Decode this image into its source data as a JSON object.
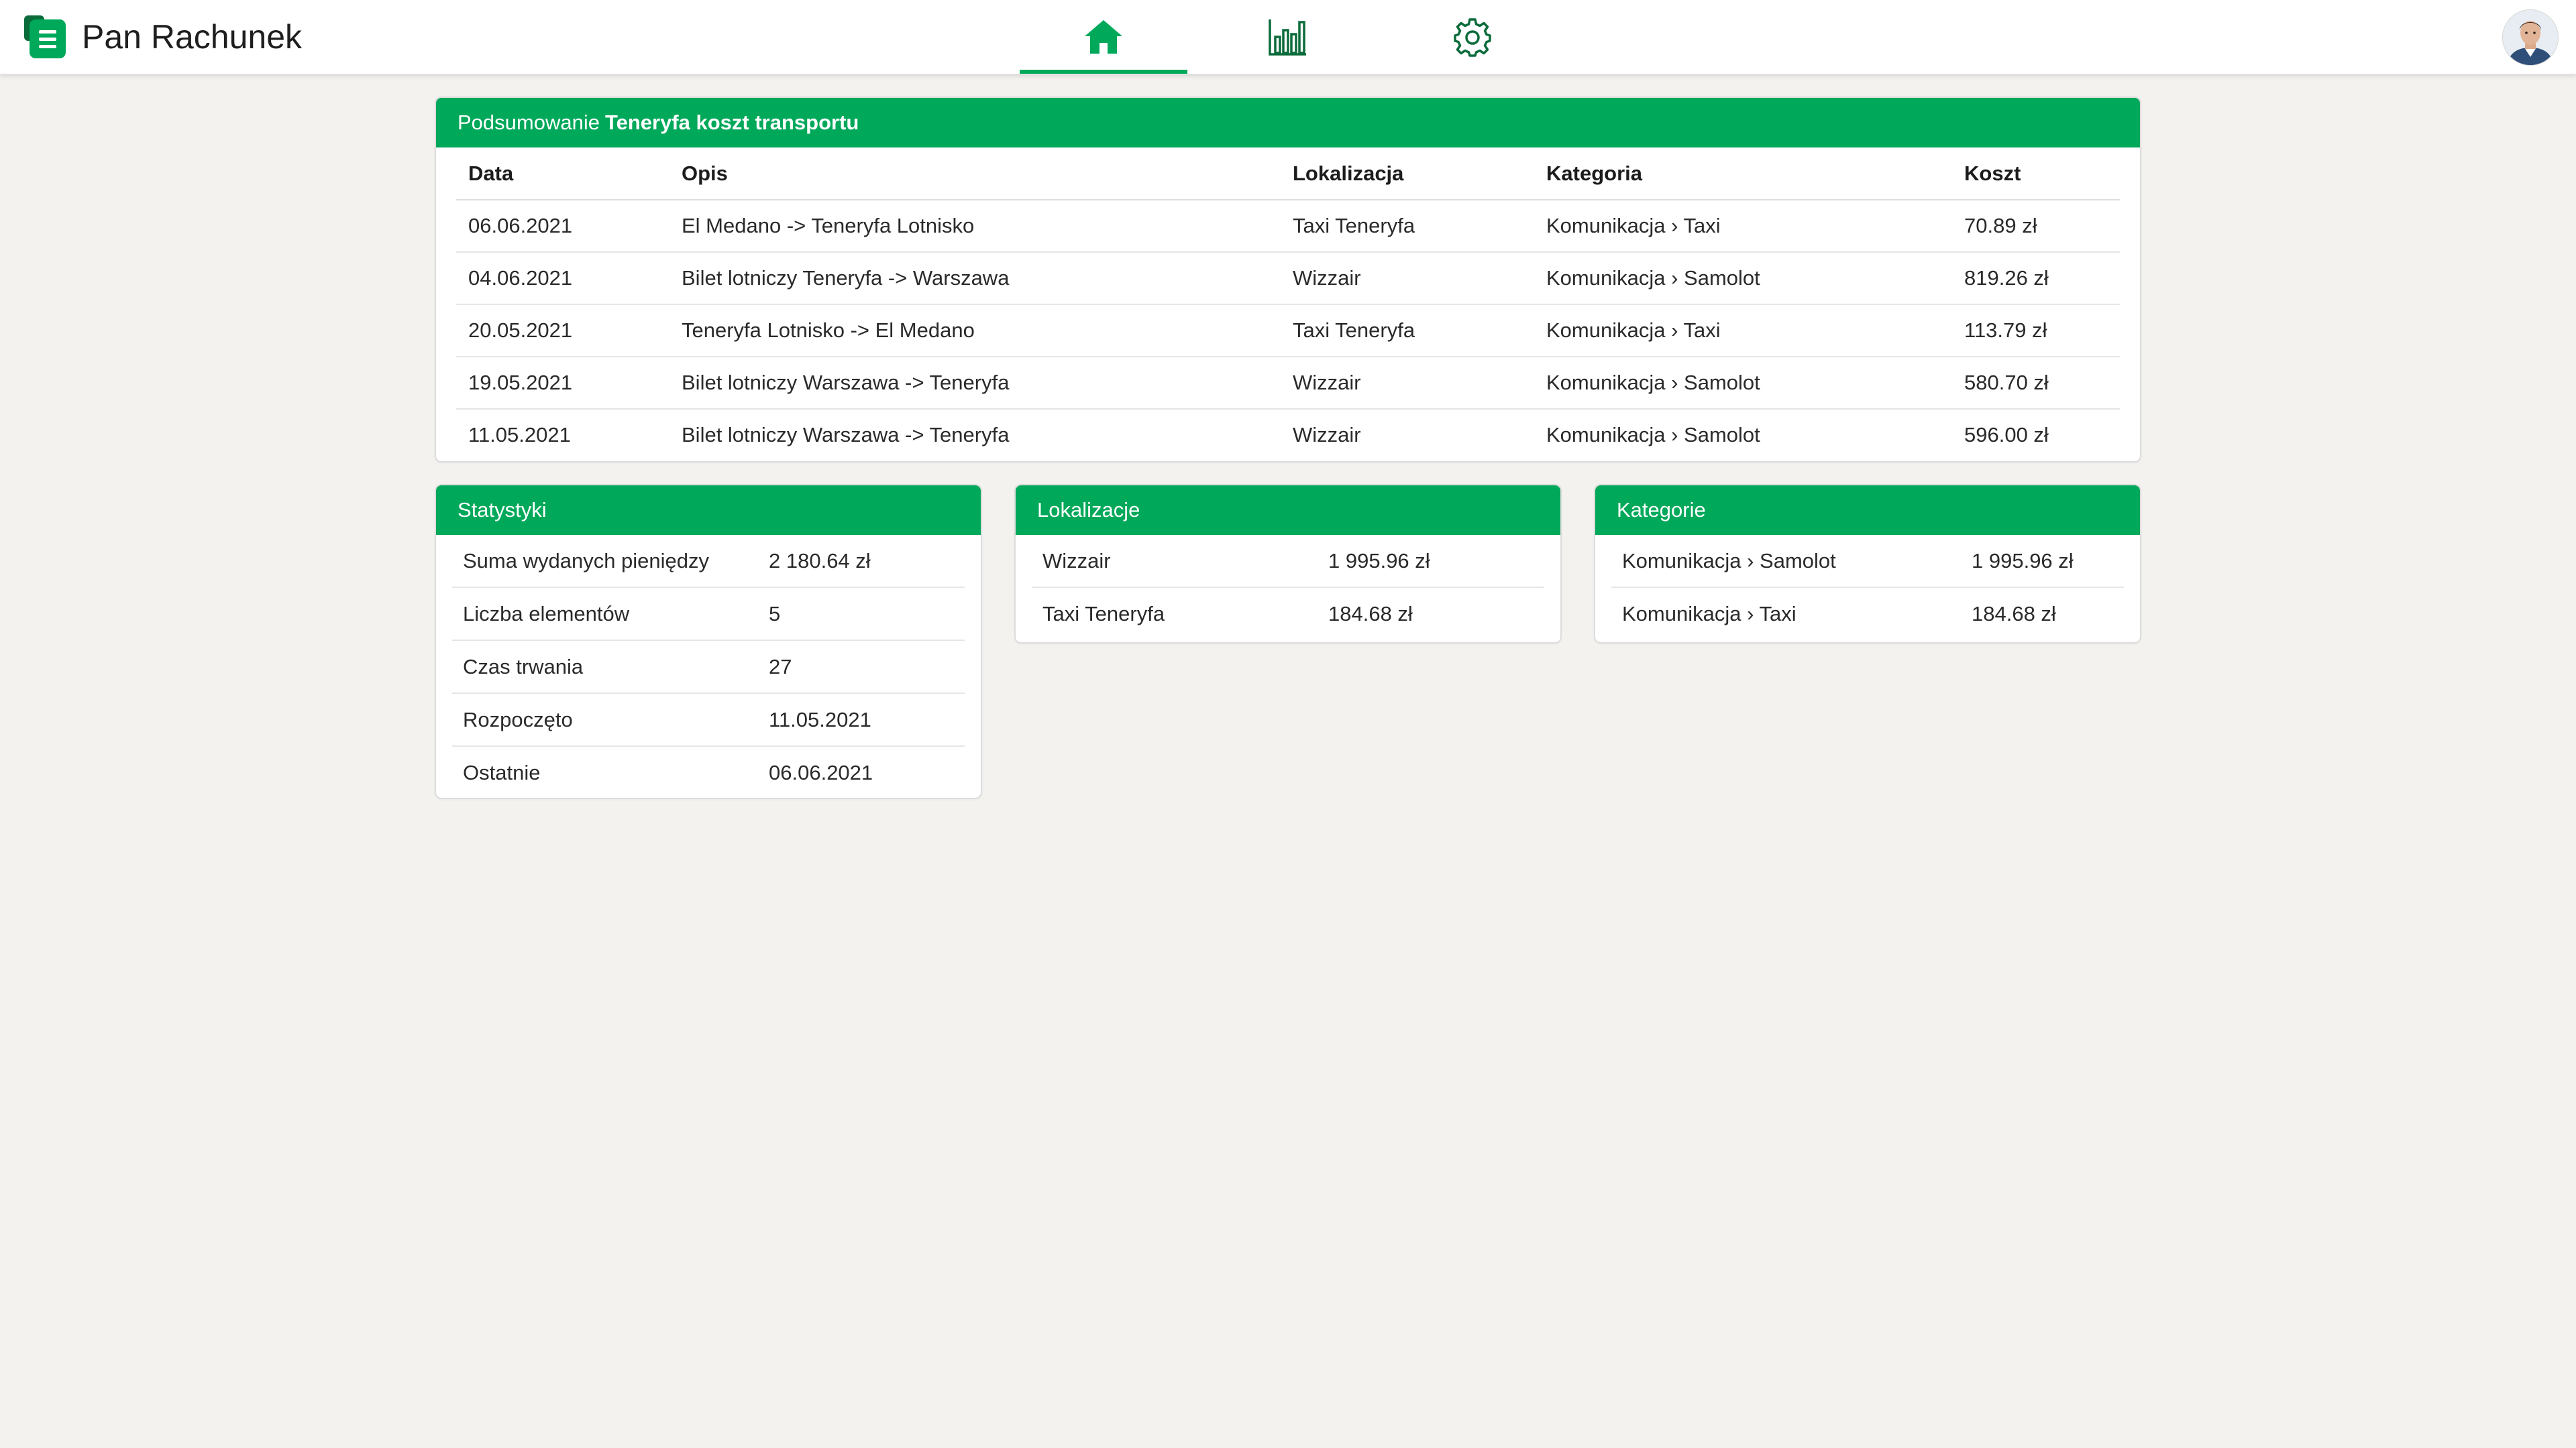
{
  "app": {
    "title": "Pan Rachunek",
    "accent_color": "#00a85a",
    "logo_icon": "receipt-logo-icon",
    "avatar_icon": "user-avatar-icon"
  },
  "nav": {
    "tabs": [
      {
        "icon": "home-icon",
        "active": true
      },
      {
        "icon": "bar-chart-icon",
        "active": false
      },
      {
        "icon": "gear-icon",
        "active": false
      }
    ]
  },
  "summary": {
    "header_prefix": "Podsumowanie",
    "header_name": "Teneryfa koszt transportu",
    "columns": [
      "Data",
      "Opis",
      "Lokalizacja",
      "Kategoria",
      "Koszt"
    ],
    "rows": [
      [
        "06.06.2021",
        "El Medano -> Teneryfa Lotnisko",
        "Taxi Teneryfa",
        "Komunikacja › Taxi",
        "70.89 zł"
      ],
      [
        "04.06.2021",
        "Bilet lotniczy Teneryfa -> Warszawa",
        "Wizzair",
        "Komunikacja › Samolot",
        "819.26 zł"
      ],
      [
        "20.05.2021",
        "Teneryfa Lotnisko -> El Medano",
        "Taxi Teneryfa",
        "Komunikacja › Taxi",
        "113.79 zł"
      ],
      [
        "19.05.2021",
        "Bilet lotniczy Warszawa -> Teneryfa",
        "Wizzair",
        "Komunikacja › Samolot",
        "580.70 zł"
      ],
      [
        "11.05.2021",
        "Bilet lotniczy Warszawa -> Teneryfa",
        "Wizzair",
        "Komunikacja › Samolot",
        "596.00 zł"
      ]
    ]
  },
  "stats": {
    "header": "Statystyki",
    "rows": [
      [
        "Suma wydanych pieniędzy",
        "2 180.64 zł"
      ],
      [
        "Liczba elementów",
        "5"
      ],
      [
        "Czas trwania",
        "27"
      ],
      [
        "Rozpoczęto",
        "11.05.2021"
      ],
      [
        "Ostatnie",
        "06.06.2021"
      ]
    ]
  },
  "locations": {
    "header": "Lokalizacje",
    "rows": [
      [
        "Wizzair",
        "1 995.96 zł"
      ],
      [
        "Taxi Teneryfa",
        "184.68 zł"
      ]
    ]
  },
  "categories": {
    "header": "Kategorie",
    "rows": [
      [
        "Komunikacja › Samolot",
        "1 995.96 zł"
      ],
      [
        "Komunikacja › Taxi",
        "184.68 zł"
      ]
    ]
  }
}
